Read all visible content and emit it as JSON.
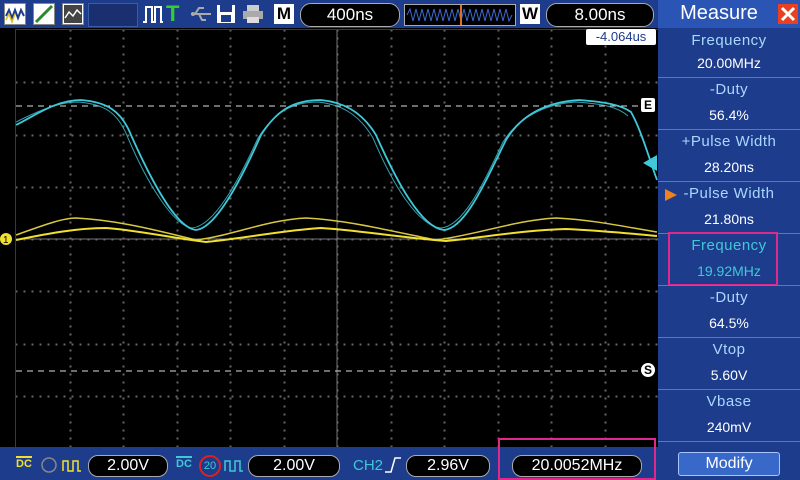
{
  "colors": {
    "ch1": "#f0e030",
    "ch2": "#40c8d8",
    "panel_bg": "#1e3c8c",
    "highlight": "#e0288c"
  },
  "topbar": {
    "mode_icons": [
      "waveform-icon",
      "ramp-icon",
      "screen-icon"
    ],
    "run_icons": [
      "pulse-icon",
      "trigger-icon",
      "usb-icon",
      "save-icon",
      "printer-icon"
    ],
    "m_label": "M",
    "timebase": "400ns",
    "w_label": "W",
    "window_timebase": "8.00ns",
    "trigger_delay": "-4.064us"
  },
  "markers": {
    "e_marker": "E",
    "s_marker": "S"
  },
  "bottombar": {
    "ch1_coupling": "DC",
    "ch1_volts": "2.00V",
    "ch2_coupling": "DC",
    "ch2_bw": "20",
    "ch2_volts": "2.00V",
    "trigger_source": "CH2",
    "trigger_level": "2.96V",
    "counter": "20.0052MHz"
  },
  "measure": {
    "title": "Measure",
    "items": [
      {
        "label": "Frequency",
        "value": "20.00MHz"
      },
      {
        "label": "-Duty",
        "value": "56.4%"
      },
      {
        "label": "+Pulse Width",
        "value": "28.20ns"
      },
      {
        "label": "-Pulse Width",
        "value": "21.80ns"
      },
      {
        "label": "Frequency",
        "value": "19.92MHz"
      },
      {
        "label": "-Duty",
        "value": "64.5%"
      },
      {
        "label": "Vtop",
        "value": "5.60V"
      },
      {
        "label": "Vbase",
        "value": "240mV"
      }
    ],
    "modify_label": "Modify"
  }
}
